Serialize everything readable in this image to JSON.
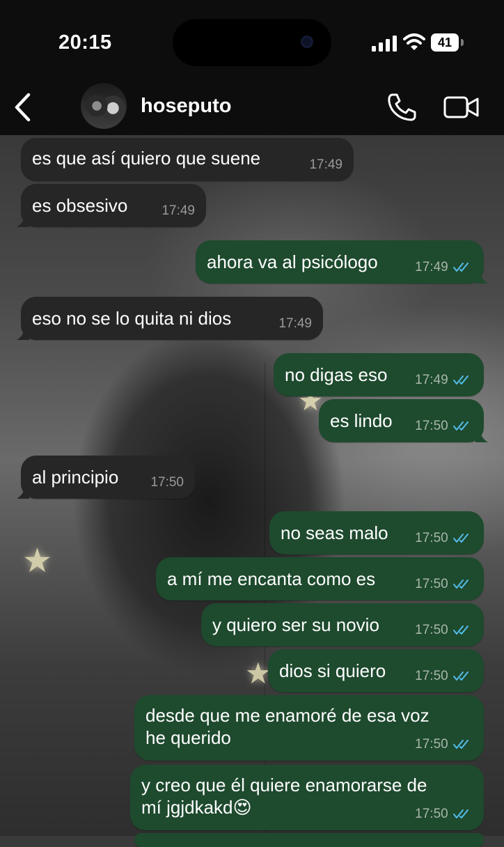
{
  "status_bar": {
    "time": "20:15",
    "battery": "41"
  },
  "header": {
    "contact_name": "hoseputo"
  },
  "messages": [
    {
      "dir": "in",
      "lines": [
        "es que así quiero que suene"
      ],
      "time": "17:49"
    },
    {
      "dir": "in",
      "lines": [
        "es obsesivo"
      ],
      "time": "17:49"
    },
    {
      "dir": "out",
      "lines": [
        "ahora va al psicólogo"
      ],
      "time": "17:49"
    },
    {
      "dir": "in",
      "lines": [
        "eso no se lo quita ni dios"
      ],
      "time": "17:49"
    },
    {
      "dir": "out",
      "lines": [
        "no digas eso"
      ],
      "time": "17:49"
    },
    {
      "dir": "out",
      "lines": [
        "es lindo"
      ],
      "time": "17:50"
    },
    {
      "dir": "in",
      "lines": [
        "al principio"
      ],
      "time": "17:50"
    },
    {
      "dir": "out",
      "lines": [
        "no seas malo"
      ],
      "time": "17:50"
    },
    {
      "dir": "out",
      "lines": [
        "a mí me encanta como es"
      ],
      "time": "17:50"
    },
    {
      "dir": "out",
      "lines": [
        "y quiero ser su novio"
      ],
      "time": "17:50"
    },
    {
      "dir": "out",
      "lines": [
        "dios si quiero"
      ],
      "time": "17:50"
    },
    {
      "dir": "out",
      "lines": [
        "desde que me enamoré de esa voz",
        "he querido"
      ],
      "time": "17:50"
    },
    {
      "dir": "out",
      "lines": [
        "y creo que él quiere enamorarse de",
        "mí jgjdkakd😍"
      ],
      "time": "17:50"
    }
  ],
  "colors": {
    "incoming_bubble": "#262626",
    "outgoing_bubble": "#1e4a2e",
    "read_ticks": "#53bdeb",
    "header_bg": "#0d0d0d"
  },
  "icons": [
    "back-chevron-icon",
    "phone-icon",
    "video-camera-icon",
    "double-check-icon",
    "signal-icon",
    "wifi-icon",
    "battery-icon"
  ]
}
